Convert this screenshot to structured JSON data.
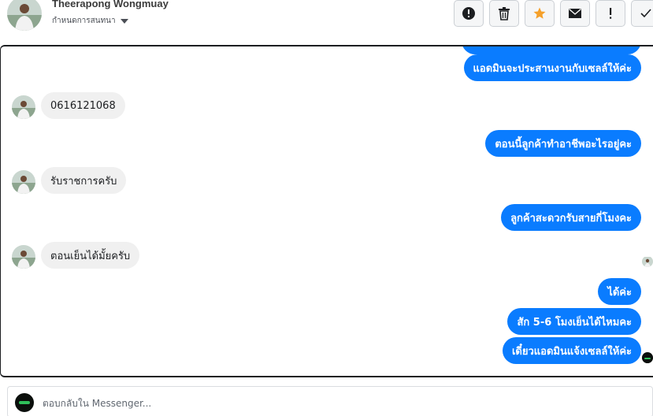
{
  "header": {
    "contact_name": "Theerapong Wongmuay",
    "subtitle": "กำหนดการสนทนา",
    "actions": [
      {
        "icon": "alert-circle-icon",
        "label": "Report"
      },
      {
        "icon": "trash-icon",
        "label": "Delete"
      },
      {
        "icon": "star-icon",
        "label": "Star",
        "color": "#f5a02a"
      },
      {
        "icon": "envelope-icon",
        "label": "Mark unread"
      },
      {
        "icon": "exclamation-icon",
        "label": "Follow up"
      },
      {
        "icon": "check-icon",
        "label": "Done"
      }
    ]
  },
  "messages": [
    {
      "side": "out",
      "text": "แอดมินจะประสานงานกับเซลล์ให้ค่ะ"
    },
    {
      "side": "in",
      "text": "0616121068"
    },
    {
      "side": "out",
      "text": "ตอนนี้ลูกค้าทำอาชีพอะไรอยู่คะ"
    },
    {
      "side": "in",
      "text": "รับราชการครับ"
    },
    {
      "side": "out",
      "text": "ลูกค้าสะดวกรับสายกี่โมงคะ"
    },
    {
      "side": "in",
      "text": "ตอนเย็นได้มั้ยครับ"
    },
    {
      "side": "out",
      "text": "ได้ค่ะ"
    },
    {
      "side": "out",
      "text": "สัก 5-6 โมงเย็นได้ไหมคะ"
    },
    {
      "side": "out",
      "text": "เดี๋ยวแอดมินแจ้งเซลล์ให้ค่ะ"
    }
  ],
  "composer": {
    "placeholder": "ตอบกลับใน Messenger..."
  },
  "colors": {
    "outgoing_bubble": "#0a7cff",
    "incoming_bubble": "#f0f0f0",
    "star": "#f5a02a"
  }
}
